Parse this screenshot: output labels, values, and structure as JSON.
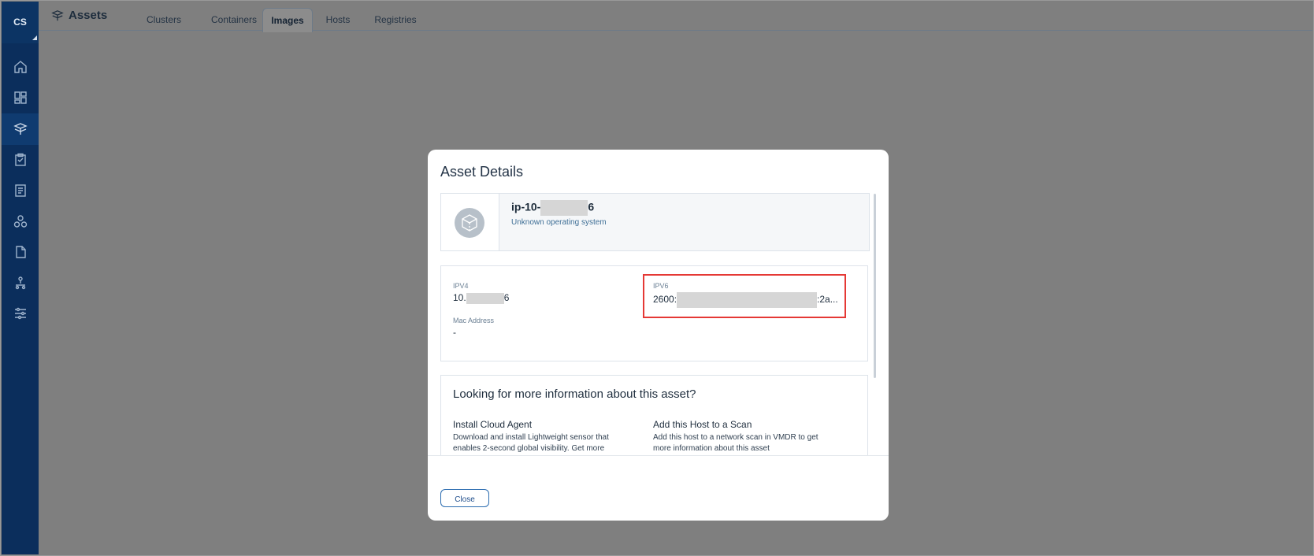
{
  "sidebar": {
    "logo": "CS",
    "items": [
      {
        "icon": "home-icon"
      },
      {
        "icon": "dashboard-icon"
      },
      {
        "icon": "assets-icon"
      },
      {
        "icon": "clipboard-icon"
      },
      {
        "icon": "report-icon"
      },
      {
        "icon": "people-icon"
      },
      {
        "icon": "document-icon"
      },
      {
        "icon": "connector-icon"
      },
      {
        "icon": "settings-sliders-icon"
      }
    ]
  },
  "header": {
    "title": "Assets",
    "tabs": [
      {
        "label": "Clusters"
      },
      {
        "label": "Containers"
      },
      {
        "label": "Images"
      },
      {
        "label": "Hosts"
      },
      {
        "label": "Registries"
      }
    ],
    "active_tab": "Images"
  },
  "modal": {
    "title": "Asset Details",
    "host": {
      "name_prefix": "ip-10-",
      "name_suffix": "6",
      "os": "Unknown operating system"
    },
    "network": {
      "ipv4_label": "IPV4",
      "ipv4_prefix": "10.",
      "ipv4_suffix": "6",
      "ipv6_label": "IPV6",
      "ipv6_prefix": "2600:",
      "ipv6_suffix": ":2a...",
      "mac_label": "Mac Address",
      "mac_value": "-"
    },
    "more_info": {
      "title": "Looking for more information about this asset?",
      "options": [
        {
          "title": "Install Cloud Agent",
          "description": "Download and install Lightweight sensor that enables 2-second global visibility. Get more information about this asset"
        },
        {
          "title": "Add this Host to a Scan",
          "description": "Add this host to a network scan in VMDR to get more information about this asset"
        }
      ]
    },
    "close_label": "Close"
  },
  "colors": {
    "sidebar_bg": "#0b2e5c",
    "overlay": "#7f7f7f",
    "highlight_border": "#e53935",
    "button_accent": "#2b6cb0"
  }
}
